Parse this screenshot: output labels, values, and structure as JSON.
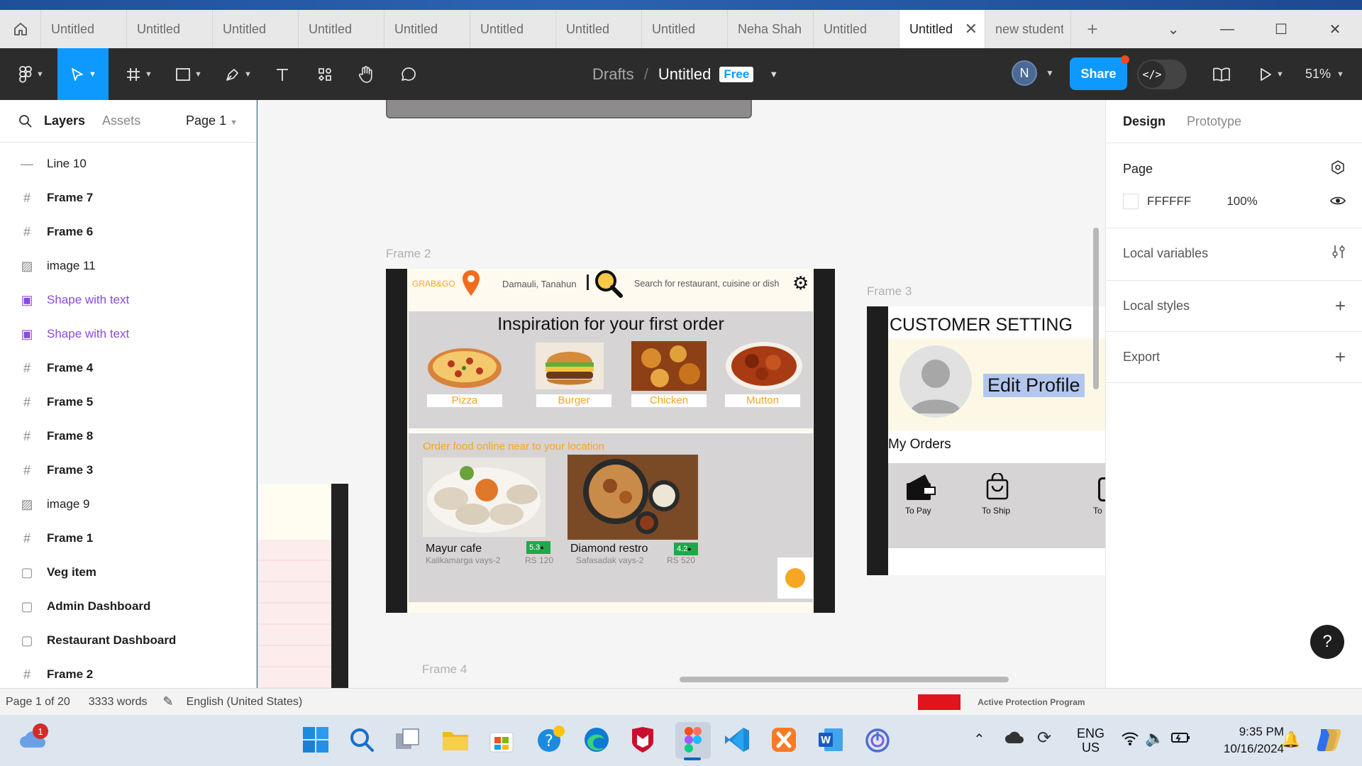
{
  "tabs": [
    {
      "label": "Untitled"
    },
    {
      "label": "Untitled"
    },
    {
      "label": "Untitled"
    },
    {
      "label": "Untitled"
    },
    {
      "label": "Untitled"
    },
    {
      "label": "Untitled"
    },
    {
      "label": "Untitled"
    },
    {
      "label": "Untitled"
    },
    {
      "label": "Neha Shah"
    },
    {
      "label": "Untitled"
    },
    {
      "label": "Untitled",
      "active": true
    },
    {
      "label": "new student"
    }
  ],
  "toolbar": {
    "breadcrumb_parent": "Drafts",
    "breadcrumb_sep": "/",
    "file_title": "Untitled",
    "plan_badge": "Free",
    "avatar_initial": "N",
    "share_label": "Share",
    "zoom": "51%"
  },
  "left_panel": {
    "tab_layers": "Layers",
    "tab_assets": "Assets",
    "page_selector": "Page 1",
    "layers": [
      {
        "name": "Line 10",
        "icon": "line-icon"
      },
      {
        "name": "Frame 7",
        "icon": "frame-icon"
      },
      {
        "name": "Frame 6",
        "icon": "frame-icon"
      },
      {
        "name": "image 11",
        "icon": "image-icon"
      },
      {
        "name": "Shape with text",
        "icon": "shape-text-icon"
      },
      {
        "name": "Shape with text",
        "icon": "shape-text-icon"
      },
      {
        "name": "Frame 4",
        "icon": "frame-icon"
      },
      {
        "name": "Frame 5",
        "icon": "frame-icon"
      },
      {
        "name": "Frame 8",
        "icon": "frame-icon"
      },
      {
        "name": "Frame 3",
        "icon": "frame-icon"
      },
      {
        "name": "image 9",
        "icon": "image-icon"
      },
      {
        "name": "Frame 1",
        "icon": "frame-icon"
      },
      {
        "name": "Veg item",
        "icon": "section-icon"
      },
      {
        "name": "Admin Dashboard",
        "icon": "section-icon"
      },
      {
        "name": "Restaurant Dashboard",
        "icon": "section-icon"
      },
      {
        "name": "Frame 2",
        "icon": "frame-icon"
      }
    ]
  },
  "right_panel": {
    "tab_design": "Design",
    "tab_prototype": "Prototype",
    "page_heading": "Page",
    "page_color": "FFFFFF",
    "page_opacity": "100%",
    "local_variables": "Local variables",
    "local_styles": "Local styles",
    "export": "Export",
    "help": "?"
  },
  "canvas": {
    "frame2_label": "Frame 2",
    "frame3_label": "Frame 3",
    "frame4_label": "Frame 4",
    "app": {
      "brand": "GRAB&GO",
      "location": "Damauli, Tanahun",
      "search_placeholder": "Search for restaurant, cuisine or dish",
      "inspiration_title": "Inspiration for your first order",
      "categories": [
        "Pizza",
        "Burger",
        "Chicken",
        "Mutton"
      ],
      "order_heading": "Order food online near to your location",
      "restaurants": [
        {
          "name": "Mayur cafe",
          "address": "Kalikamarga vays-2",
          "rating": "5.3",
          "price": "RS 120"
        },
        {
          "name": "Diamond restro",
          "address": "Safasadak vays-2",
          "rating": "4.2",
          "price": "RS 520"
        }
      ]
    },
    "customer": {
      "title": "CUSTOMER SETTING",
      "edit_profile": "Edit Profile",
      "my_orders": "My Orders",
      "order_states": [
        "To Pay",
        "To Ship",
        "To"
      ]
    }
  },
  "statusbar": {
    "page": "Page 1 of 20",
    "words": "3333 words",
    "language": "English (United States)",
    "behind_text": "Active Protection Program"
  },
  "taskbar": {
    "weather_badge": "1",
    "lang_line1": "ENG",
    "lang_line2": "US",
    "time": "9:35 PM",
    "date": "10/16/2024"
  },
  "colors": {
    "accent": "#0d99ff",
    "toolbar_bg": "#2c2c2c",
    "brand_orange": "#f5a623",
    "rating_green": "#1fa84a",
    "layer_purple": "#8a4bd9"
  }
}
